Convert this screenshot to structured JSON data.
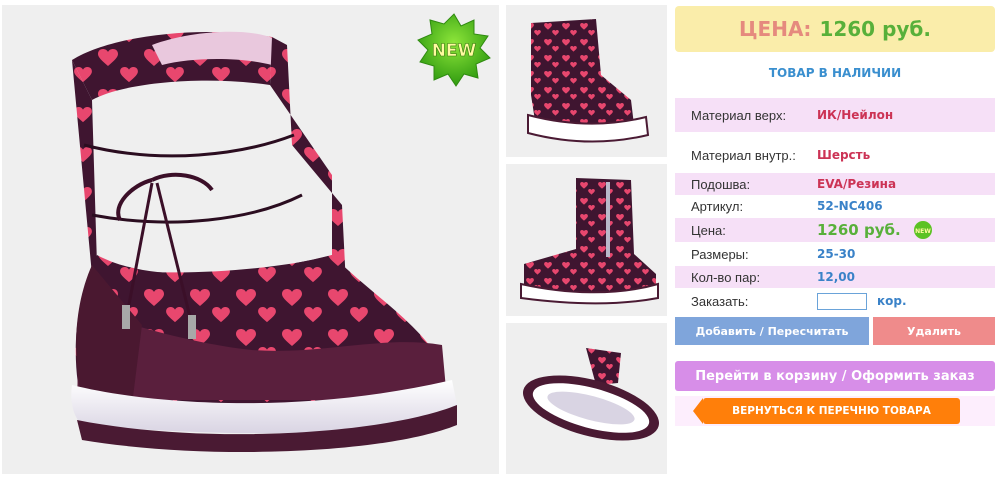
{
  "badges": {
    "new": "NEW",
    "new_small": "NEW"
  },
  "price_box": {
    "label": "ЦЕНА:",
    "value": "1260 руб."
  },
  "stock_status": "ТОВАР В НАЛИЧИИ",
  "specs": [
    {
      "label": "Материал верх:",
      "value": "ИК/Нейлон"
    },
    {
      "label": "Материал внутр.:",
      "value": "Шерсть"
    },
    {
      "label": "Подошва:",
      "value": "EVA/Резина"
    },
    {
      "label": "Артикул:",
      "value": "52-NC406"
    },
    {
      "label": "Цена:",
      "value": "1260 руб."
    },
    {
      "label": "Размеры:",
      "value": "25-30"
    },
    {
      "label": "Кол-во пар:",
      "value": "12,00"
    },
    {
      "label": "Заказать:",
      "value": "",
      "unit": "кор."
    }
  ],
  "buttons": {
    "add": "Добавить / Пересчитать",
    "delete": "Удалить",
    "cart": "Перейти в корзину / Оформить заказ",
    "back": "ВЕРНУТЬСЯ К ПЕРЕЧНЮ ТОВАРА"
  },
  "colors": {
    "boot_dark": "#4a1a33",
    "boot_mid": "#6b2a4a",
    "heart": "#e8476e",
    "price_label": "#e58a7e",
    "price_value": "#58b03a",
    "accent_blue": "#3a82c8",
    "back_orange": "#ff7f0a"
  },
  "icons": [
    "new-starburst-icon",
    "back-arrow-icon"
  ]
}
